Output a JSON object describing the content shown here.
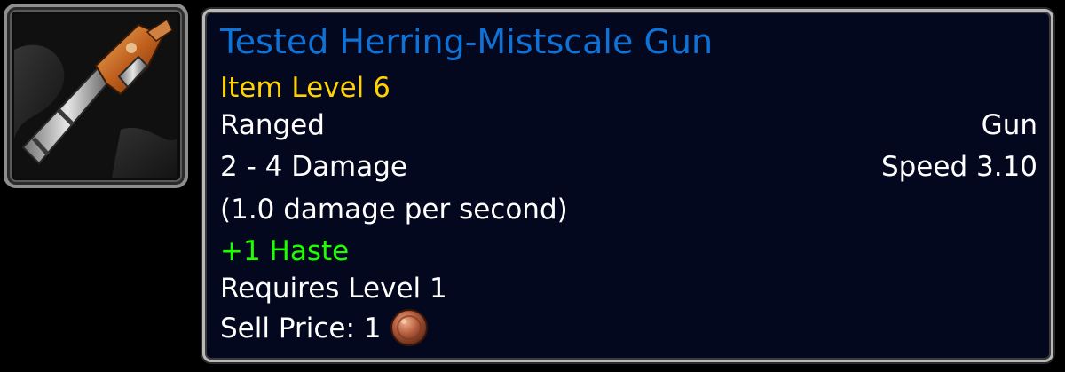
{
  "item": {
    "name": "Tested Herring-Mistscale Gun",
    "item_level": "Item Level 6",
    "slot": "Ranged",
    "weapon_type": "Gun",
    "damage": "2 - 4 Damage",
    "speed": "Speed 3.10",
    "dps": "(1.0 damage per second)",
    "stat": "+1 Haste",
    "requirement": "Requires Level 1",
    "sell_price_label": "Sell Price: 1",
    "coin_icon": "copper-coin-icon",
    "item_icon": "gun-icon"
  },
  "colors": {
    "name": "#0f72d6",
    "item_level": "#ffd200",
    "stat": "#1eff00",
    "text": "#ffffff",
    "background": "#04081f",
    "border": "#b9b9b9"
  }
}
